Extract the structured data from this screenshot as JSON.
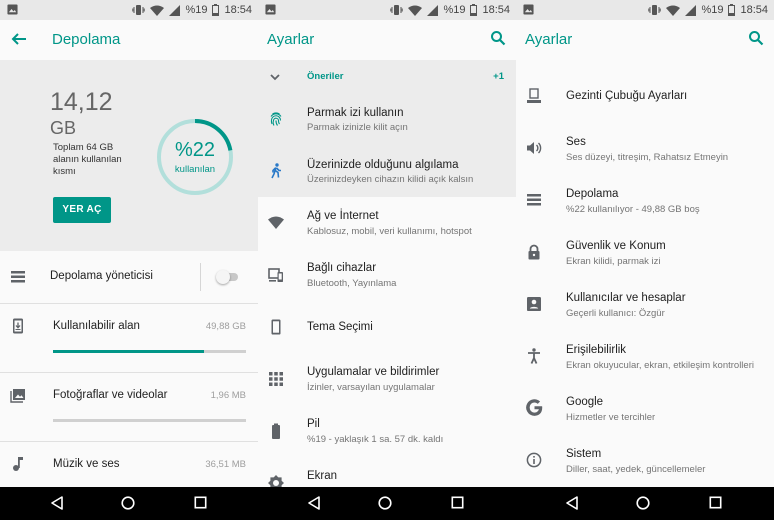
{
  "statusbar": {
    "battery": "%19",
    "time": "18:54"
  },
  "storage_screen": {
    "title": "Depolama",
    "used_number": "14,12",
    "used_unit": "GB",
    "used_caption": "Toplam 64 GB alanın kullanılan kısmı",
    "percent": "%22",
    "percent_label": "kullanılan",
    "percent_value": 22,
    "free_button": "YER AÇ",
    "manager_label": "Depolama yöneticisi",
    "manager_enabled": false,
    "items": [
      {
        "label": "Kullanılabilir alan",
        "value": "49,88 GB",
        "fill": 0.78
      },
      {
        "label": "Fotoğraflar ve videolar",
        "value": "1,96 MB",
        "fill": 0.0
      },
      {
        "label": "Müzik ve ses",
        "value": "36,51 MB",
        "fill": 0.0
      }
    ]
  },
  "settings_screen": {
    "title": "Ayarlar",
    "suggestions_label": "Öneriler",
    "suggestions_count": "+1",
    "suggestions": [
      {
        "title": "Parmak izi kullanın",
        "subtitle": "Parmak izinizle kilit açın"
      },
      {
        "title": "Üzerinizde olduğunu algılama",
        "subtitle": "Üzerinizdeyken cihazın kilidi açık kalsın"
      }
    ],
    "items": [
      {
        "title": "Ağ ve İnternet",
        "subtitle": "Kablosuz, mobil, veri kullanımı, hotspot"
      },
      {
        "title": "Bağlı cihazlar",
        "subtitle": "Bluetooth, Yayınlama"
      },
      {
        "title": "Tema Seçimi",
        "subtitle": ""
      },
      {
        "title": "Uygulamalar ve bildirimler",
        "subtitle": "İzinler, varsayılan uygulamalar"
      },
      {
        "title": "Pil",
        "subtitle": "%19 - yaklaşık 1 sa. 57 dk. kaldı"
      },
      {
        "title": "Ekran",
        "subtitle": ""
      }
    ]
  },
  "settings_screen_2": {
    "title": "Ayarlar",
    "items": [
      {
        "title": "Gezinti Çubuğu Ayarları",
        "subtitle": ""
      },
      {
        "title": "Ses",
        "subtitle": "Ses düzeyi, titreşim, Rahatsız Etmeyin"
      },
      {
        "title": "Depolama",
        "subtitle": "%22 kullanılıyor - 49,88 GB boş"
      },
      {
        "title": "Güvenlik ve Konum",
        "subtitle": "Ekran kilidi, parmak izi"
      },
      {
        "title": "Kullanıcılar ve hesaplar",
        "subtitle": "Geçerli kullanıcı: Özgür"
      },
      {
        "title": "Erişilebilirlik",
        "subtitle": "Ekran okuyucular, ekran, etkileşim kontrolleri"
      },
      {
        "title": "Google",
        "subtitle": "Hizmetler ve tercihler"
      },
      {
        "title": "Sistem",
        "subtitle": "Diller, saat, yedek, güncellemeler"
      }
    ]
  },
  "colors": {
    "accent": "#009688",
    "ring_track": "#b2dfdb",
    "icon": "#5f6368"
  }
}
